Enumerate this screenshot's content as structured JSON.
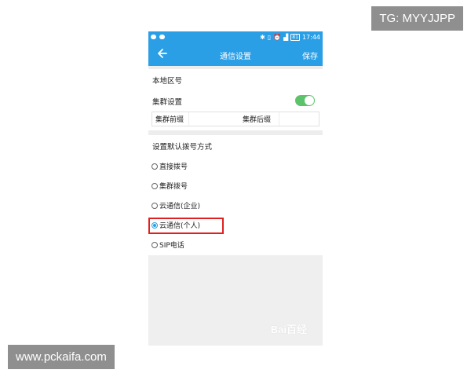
{
  "watermarks": {
    "top_right": "TG: MYYJJPP",
    "bottom_left": "www.pckaifa.com",
    "baidu": "Bai百经"
  },
  "status_bar": {
    "battery": "81",
    "time": "17:44",
    "icons": [
      "bluetooth-icon",
      "vibrate-icon",
      "alarm-icon",
      "signal-icon"
    ]
  },
  "app_bar": {
    "back_icon": "back-arrow-icon",
    "title": "通信设置",
    "save_label": "保存"
  },
  "settings": {
    "area_code_label": "本地区号",
    "cluster_label": "集群设置",
    "cluster_enabled": true,
    "prefix_label": "集群前缀",
    "suffix_label": "集群后缀"
  },
  "dial_mode": {
    "heading": "设置默认拨号方式",
    "options": [
      {
        "label": "直接拨号",
        "checked": false
      },
      {
        "label": "集群拨号",
        "checked": false
      },
      {
        "label": "云通信(企业)",
        "checked": false
      },
      {
        "label": "云通信(个人)",
        "checked": true
      },
      {
        "label": "SIP电话",
        "checked": false
      }
    ]
  },
  "colors": {
    "app_bar": "#2a9fe6",
    "toggle_on": "#5cc36a",
    "highlight": "#e02020"
  }
}
